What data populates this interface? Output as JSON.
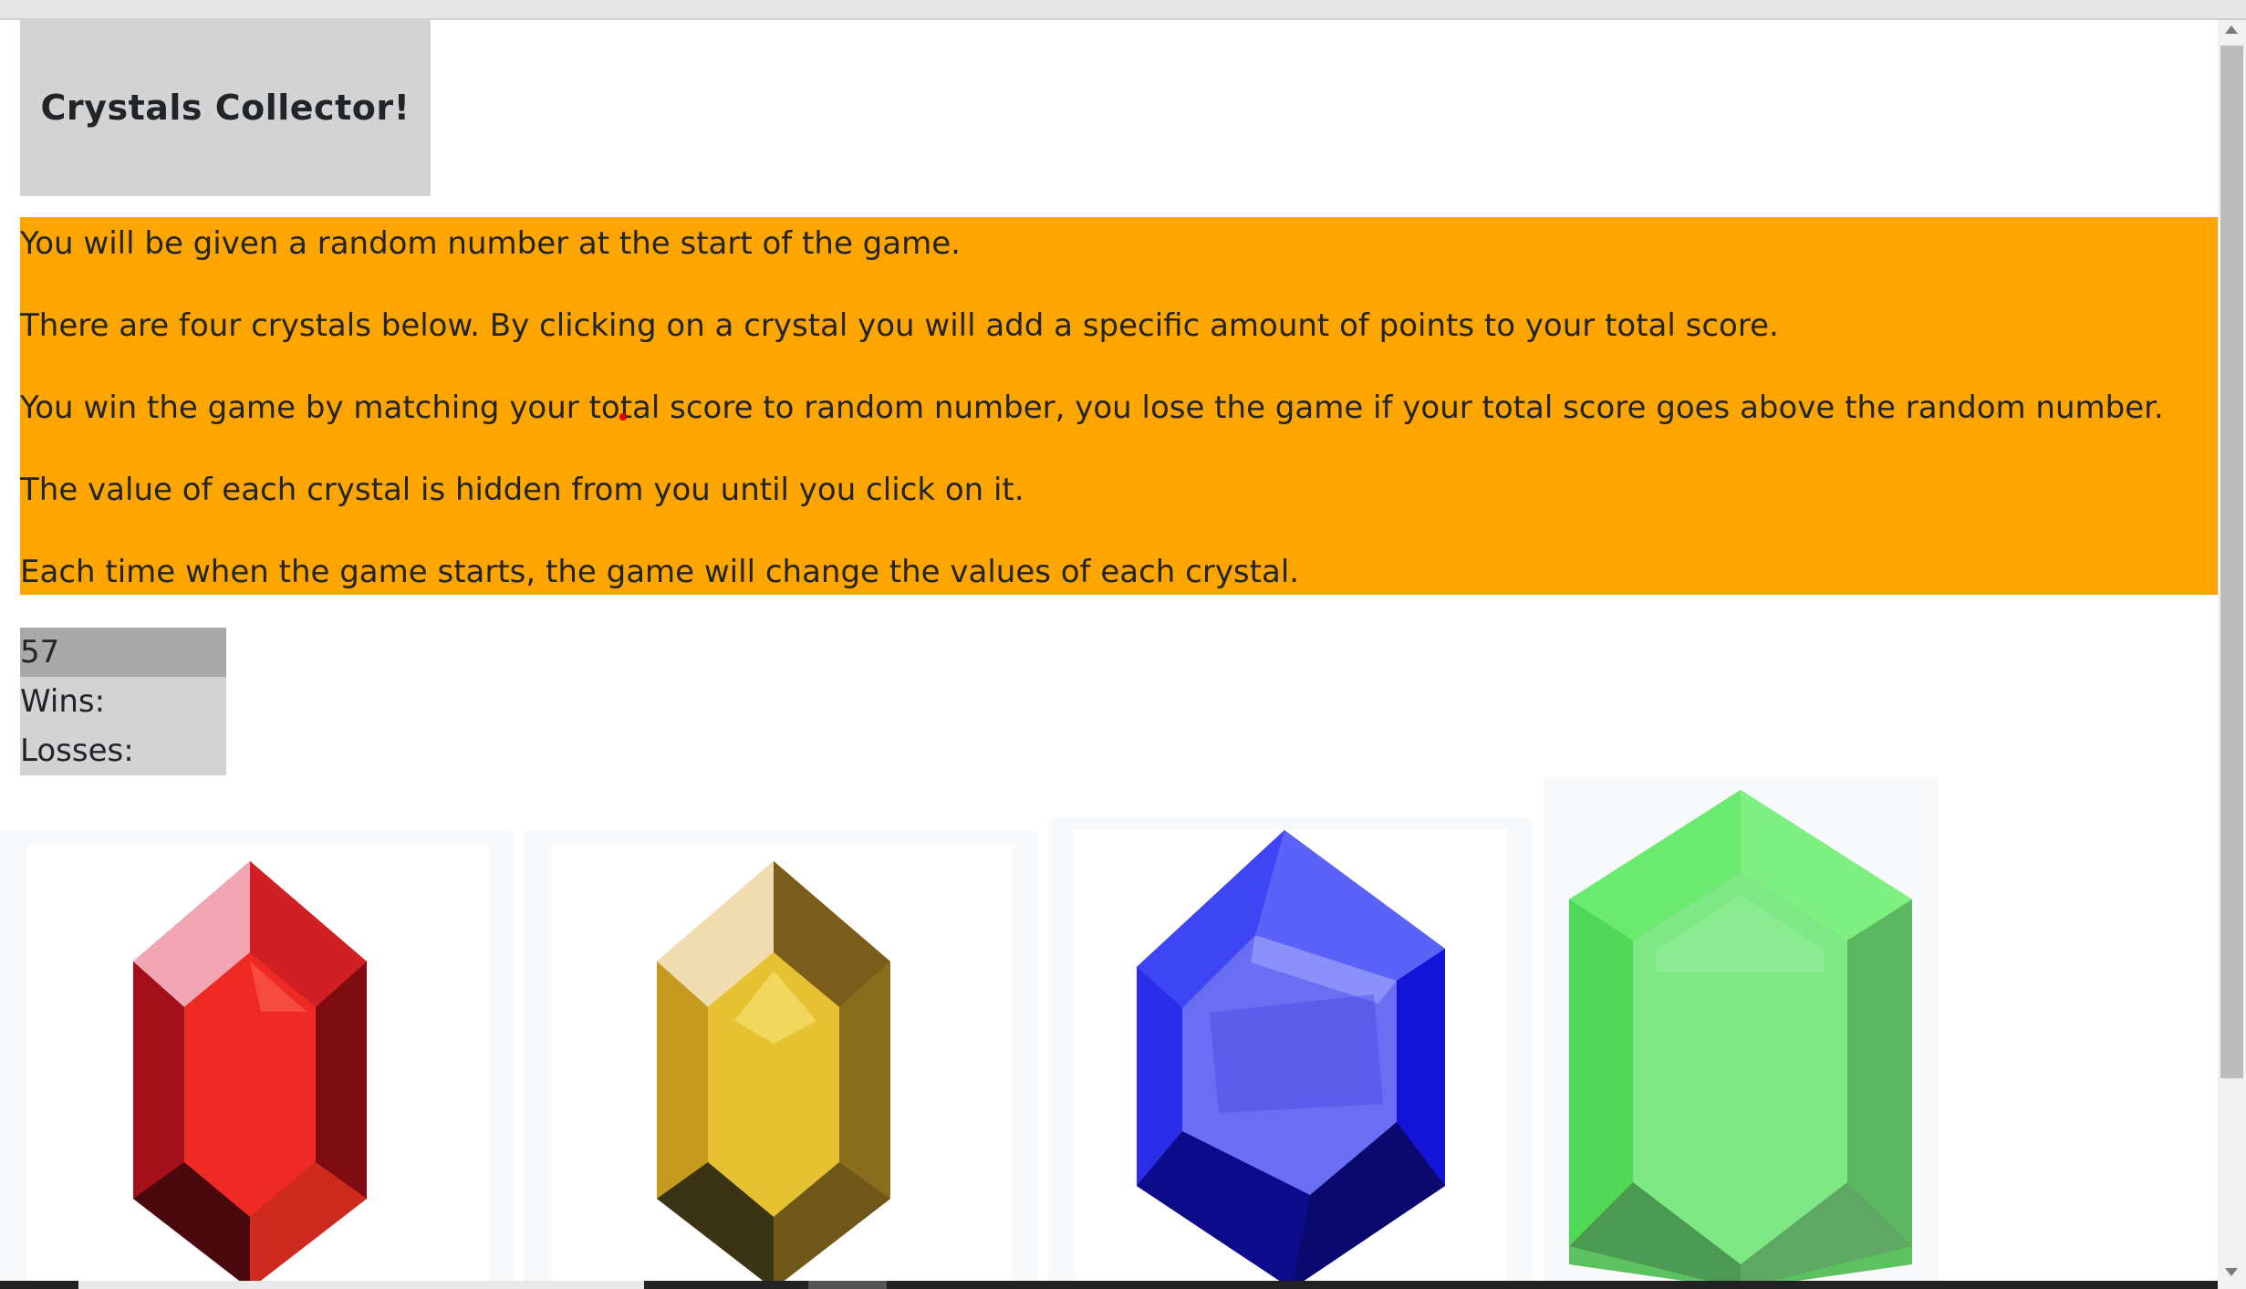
{
  "header": {
    "title": "Crystals Collector!"
  },
  "instructions": [
    "You will be given a random number at the start of the game.",
    "There are four crystals below. By clicking on a crystal you will add a specific amount of points to your total score.",
    "You win the game by matching your total score to random number, you lose the game if your total score goes above the random number.",
    "The value of each crystal is hidden from you until you click on it.",
    "Each time when the game starts, the game will change the values of each crystal."
  ],
  "stats": {
    "target_number": "57",
    "wins_label": "Wins:",
    "losses_label": "Losses:"
  },
  "crystals": [
    {
      "name": "red-crystal",
      "color": "#d4141a"
    },
    {
      "name": "gold-crystal",
      "color": "#d6ad24"
    },
    {
      "name": "blue-crystal",
      "color": "#2a2ff0"
    },
    {
      "name": "green-crystal",
      "color": "#5fe36a"
    }
  ],
  "colors": {
    "instructions_bg": "#ffa500",
    "title_bg": "#d3d3d3",
    "target_bg": "#a9a9a9"
  }
}
